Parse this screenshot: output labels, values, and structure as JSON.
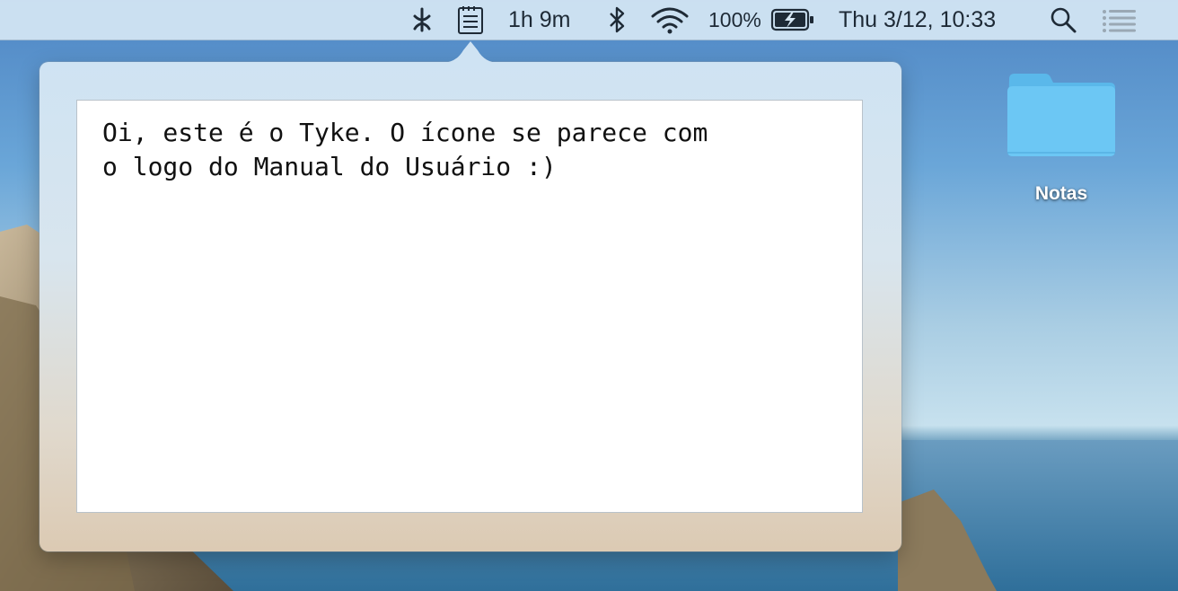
{
  "menubar": {
    "icons": [
      "tyke-icon",
      "note-icon",
      "bluetooth-icon",
      "wifi-icon",
      "battery-charging-icon",
      "search-icon",
      "notification-center-icon"
    ],
    "battery_time": "1h 9m",
    "battery_percent": "100%",
    "clock": "Thu 3/12, 10:33"
  },
  "note": {
    "content": "Oi, este é o Tyke. O ícone se parece com\no logo do Manual do Usuário :)"
  },
  "desktop": {
    "folder_label": "Notas",
    "folder_color": "#6cc7f4"
  }
}
